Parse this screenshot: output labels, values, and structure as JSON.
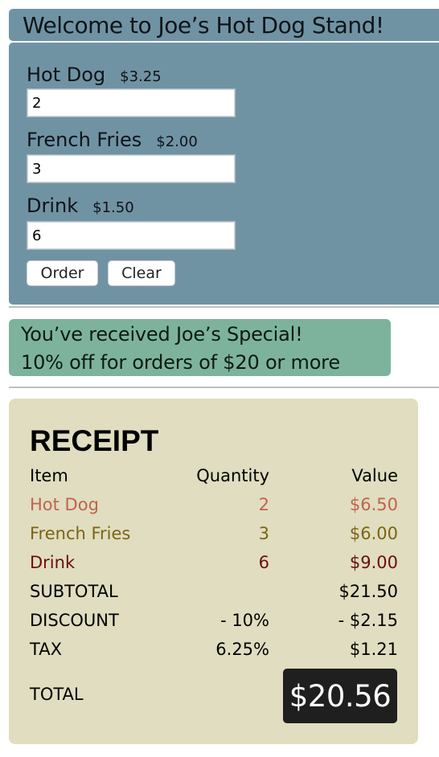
{
  "header": {
    "title": "Welcome to Joe’s Hot Dog Stand!"
  },
  "order_form": {
    "items": [
      {
        "name": "Hot Dog",
        "price": "$3.25",
        "quantity": "2"
      },
      {
        "name": "French Fries",
        "price": "$2.00",
        "quantity": "3"
      },
      {
        "name": "Drink",
        "price": "$1.50",
        "quantity": "6"
      }
    ],
    "order_label": "Order",
    "clear_label": "Clear"
  },
  "special": {
    "line1": "You’ve received Joe’s Special!",
    "line2": "10% off for orders of $20 or more"
  },
  "receipt": {
    "title": "RECEIPT",
    "columns": [
      "Item",
      "Quantity",
      "Value"
    ],
    "lines": [
      {
        "item": "Hot Dog",
        "quantity": "2",
        "value": "$6.50"
      },
      {
        "item": "French Fries",
        "quantity": "3",
        "value": "$6.00"
      },
      {
        "item": "Drink",
        "quantity": "6",
        "value": "$9.00"
      }
    ],
    "subtotal": {
      "label": "SUBTOTAL",
      "value": "$21.50"
    },
    "discount": {
      "label": "DISCOUNT",
      "rate": "- 10%",
      "value": "- $2.15"
    },
    "tax": {
      "label": "TAX",
      "rate": "6.25%",
      "value": "$1.21"
    },
    "total": {
      "label": "TOTAL",
      "value": "$20.56"
    }
  },
  "colors": {
    "panel": "#7093a4",
    "special": "#7db39c",
    "receipt": "#e0ddc0",
    "hot_dog": "#c0644a",
    "french_fries": "#7d6412",
    "drink": "#6a0f0a",
    "total_box": "#1f1f1f"
  }
}
